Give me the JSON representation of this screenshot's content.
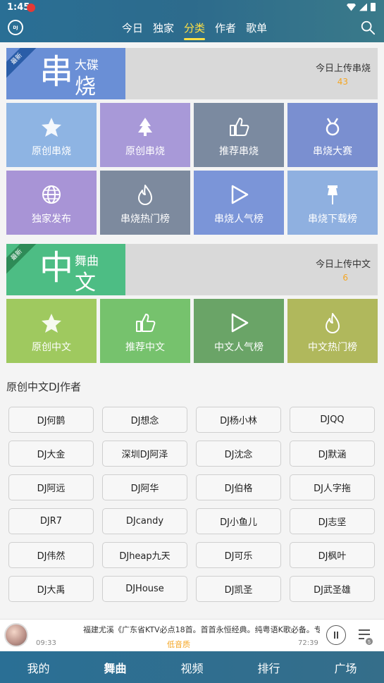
{
  "status": {
    "time": "1:45"
  },
  "app": {
    "logo_text": "DJ"
  },
  "tabs": [
    {
      "label": "今日",
      "active": false
    },
    {
      "label": "独家",
      "active": false
    },
    {
      "label": "分类",
      "active": true
    },
    {
      "label": "作者",
      "active": false
    },
    {
      "label": "歌单",
      "active": false
    }
  ],
  "banner_chuanshao": {
    "corner": "最新",
    "big_char": "串",
    "small_text": "大碟",
    "small_char": "烧",
    "today_label": "今日上传串烧",
    "today_count": "43",
    "color": "#6a8fd6"
  },
  "chuanshao_tiles": [
    {
      "label": "原创串烧",
      "icon": "star-icon",
      "color": "#8eb4e3"
    },
    {
      "label": "原创串烧",
      "icon": "tree-icon",
      "color": "#a899d8"
    },
    {
      "label": "推荐串烧",
      "icon": "thumbs-up-icon",
      "color": "#7b8aa0"
    },
    {
      "label": "串烧大赛",
      "icon": "medal-icon",
      "color": "#7a8fd0"
    },
    {
      "label": "独家发布",
      "icon": "globe-icon",
      "color": "#a894d6"
    },
    {
      "label": "串烧热门榜",
      "icon": "flame-icon",
      "color": "#7d8a9e"
    },
    {
      "label": "串烧人气榜",
      "icon": "play-icon",
      "color": "#7b95d8"
    },
    {
      "label": "串烧下载榜",
      "icon": "pin-icon",
      "color": "#8fb0e0"
    }
  ],
  "banner_zhongwen": {
    "corner": "最新",
    "big_char": "中",
    "small_text": "舞曲",
    "small_char": "文",
    "today_label": "今日上传中文",
    "today_count": "6",
    "color": "#4dbd84"
  },
  "zhongwen_tiles": [
    {
      "label": "原创中文",
      "icon": "star-icon",
      "color": "#9fc95f"
    },
    {
      "label": "推荐中文",
      "icon": "thumbs-up-icon",
      "color": "#76c26d"
    },
    {
      "label": "中文人气榜",
      "icon": "play-icon",
      "color": "#6aa467"
    },
    {
      "label": "中文热门榜",
      "icon": "flame-icon",
      "color": "#b0b85c"
    }
  ],
  "authors": {
    "title": "原创中文DJ作者",
    "items": [
      "DJ何鹊",
      "DJ想念",
      "DJ杨小林",
      "DJQQ",
      "DJ大金",
      "深圳DJ阿泽",
      "DJ沈念",
      "DJ默涵",
      "DJ阿远",
      "DJ阿华",
      "DJ伯格",
      "DJ人字拖",
      "DJR7",
      "DJcandy",
      "DJ小鱼儿",
      "DJ志坚",
      "DJ伟然",
      "DJheap九天",
      "DJ可乐",
      "DJ枫叶",
      "DJ大禹",
      "DJHouse",
      "DJ凯圣",
      "DJ武圣雄"
    ]
  },
  "player": {
    "title": "福建尤溪《广东省KTV必点18首。首首永恒经典。纯粤语K歌必备。专",
    "elapsed": "09:33",
    "quality": "低音质",
    "duration": "72:39",
    "playlist_count": "5"
  },
  "bottom_nav": [
    {
      "label": "我的",
      "active": false
    },
    {
      "label": "舞曲",
      "active": true
    },
    {
      "label": "视频",
      "active": false
    },
    {
      "label": "排行",
      "active": false
    },
    {
      "label": "广场",
      "active": false
    }
  ]
}
